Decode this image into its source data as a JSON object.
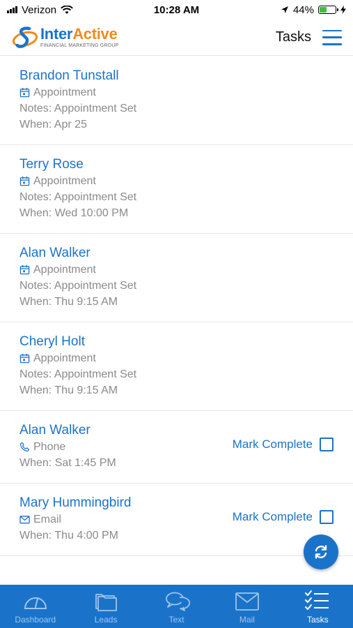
{
  "status_bar": {
    "carrier": "Verizon",
    "time": "10:28 AM",
    "battery_percent": "44%",
    "battery_level": 0.44
  },
  "header": {
    "logo_name_part1": "Inter",
    "logo_name_part2": "Active",
    "logo_subtitle": "FINANCIAL MARKETING GROUP",
    "title": "Tasks"
  },
  "tasks": [
    {
      "name": "Brandon Tunstall",
      "type": "Appointment",
      "icon": "calendar-icon",
      "notes": "Notes: Appointment Set",
      "when": "When: Apr 25"
    },
    {
      "name": "Terry Rose",
      "type": "Appointment",
      "icon": "calendar-icon",
      "notes": "Notes: Appointment Set",
      "when": "When: Wed 10:00 PM"
    },
    {
      "name": "Alan Walker",
      "type": "Appointment",
      "icon": "calendar-icon",
      "notes": "Notes: Appointment Set",
      "when": "When: Thu 9:15 AM"
    },
    {
      "name": "Cheryl Holt",
      "type": "Appointment",
      "icon": "calendar-icon",
      "notes": "Notes: Appointment Set",
      "when": "When: Thu 9:15 AM"
    },
    {
      "name": "Alan Walker",
      "type": "Phone",
      "icon": "phone-icon",
      "when": "When: Sat 1:45 PM",
      "action": "Mark Complete",
      "checked": false
    },
    {
      "name": "Mary Hummingbird",
      "type": "Email",
      "icon": "email-icon",
      "when": "When: Thu 4:00 PM",
      "action": "Mark Complete",
      "checked": false
    }
  ],
  "nav": {
    "items": [
      {
        "label": "Dashboard",
        "icon": "dashboard-gauge-icon"
      },
      {
        "label": "Leads",
        "icon": "folders-icon"
      },
      {
        "label": "Text",
        "icon": "chat-bubbles-icon"
      },
      {
        "label": "Mail",
        "icon": "mail-envelope-icon"
      },
      {
        "label": "Tasks",
        "icon": "task-checklist-icon"
      }
    ],
    "active": "Tasks"
  },
  "colors": {
    "accent": "#1b73c9",
    "logo_orange": "#f08a1c",
    "muted_text": "#8a8a8a",
    "battery_green": "#38c33a"
  }
}
